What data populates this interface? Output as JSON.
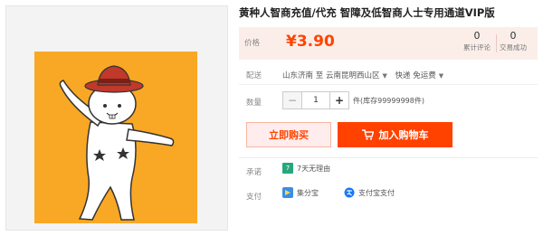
{
  "product": {
    "title": "黄种人智商充值/代充 智障及低智商人士专用通道VIP版"
  },
  "price": {
    "label": "价格",
    "value": "¥3.90",
    "reviews_count": "0",
    "reviews_label": "累计评论",
    "sales_count": "0",
    "sales_label": "交易成功"
  },
  "shipping": {
    "label": "配送",
    "from": "山东济南",
    "to_word": "至",
    "to": "云南昆明西山区",
    "method": "快递 免运费"
  },
  "quantity": {
    "label": "数量",
    "minus": "−",
    "value": "1",
    "plus": "+",
    "stock": "件(库存99999998件)"
  },
  "actions": {
    "buy_now": "立即购买",
    "add_to_cart": "加入购物车"
  },
  "promise": {
    "label": "承诺",
    "badge": "7",
    "text": "7天无理由"
  },
  "payment": {
    "label": "支付",
    "method_1": "集分宝",
    "method_2": "支付宝支付"
  },
  "colors": {
    "price": "#ff4400",
    "cart_button": "#ff4200",
    "image_background": "#f9a825",
    "hat": "#c0392b"
  }
}
